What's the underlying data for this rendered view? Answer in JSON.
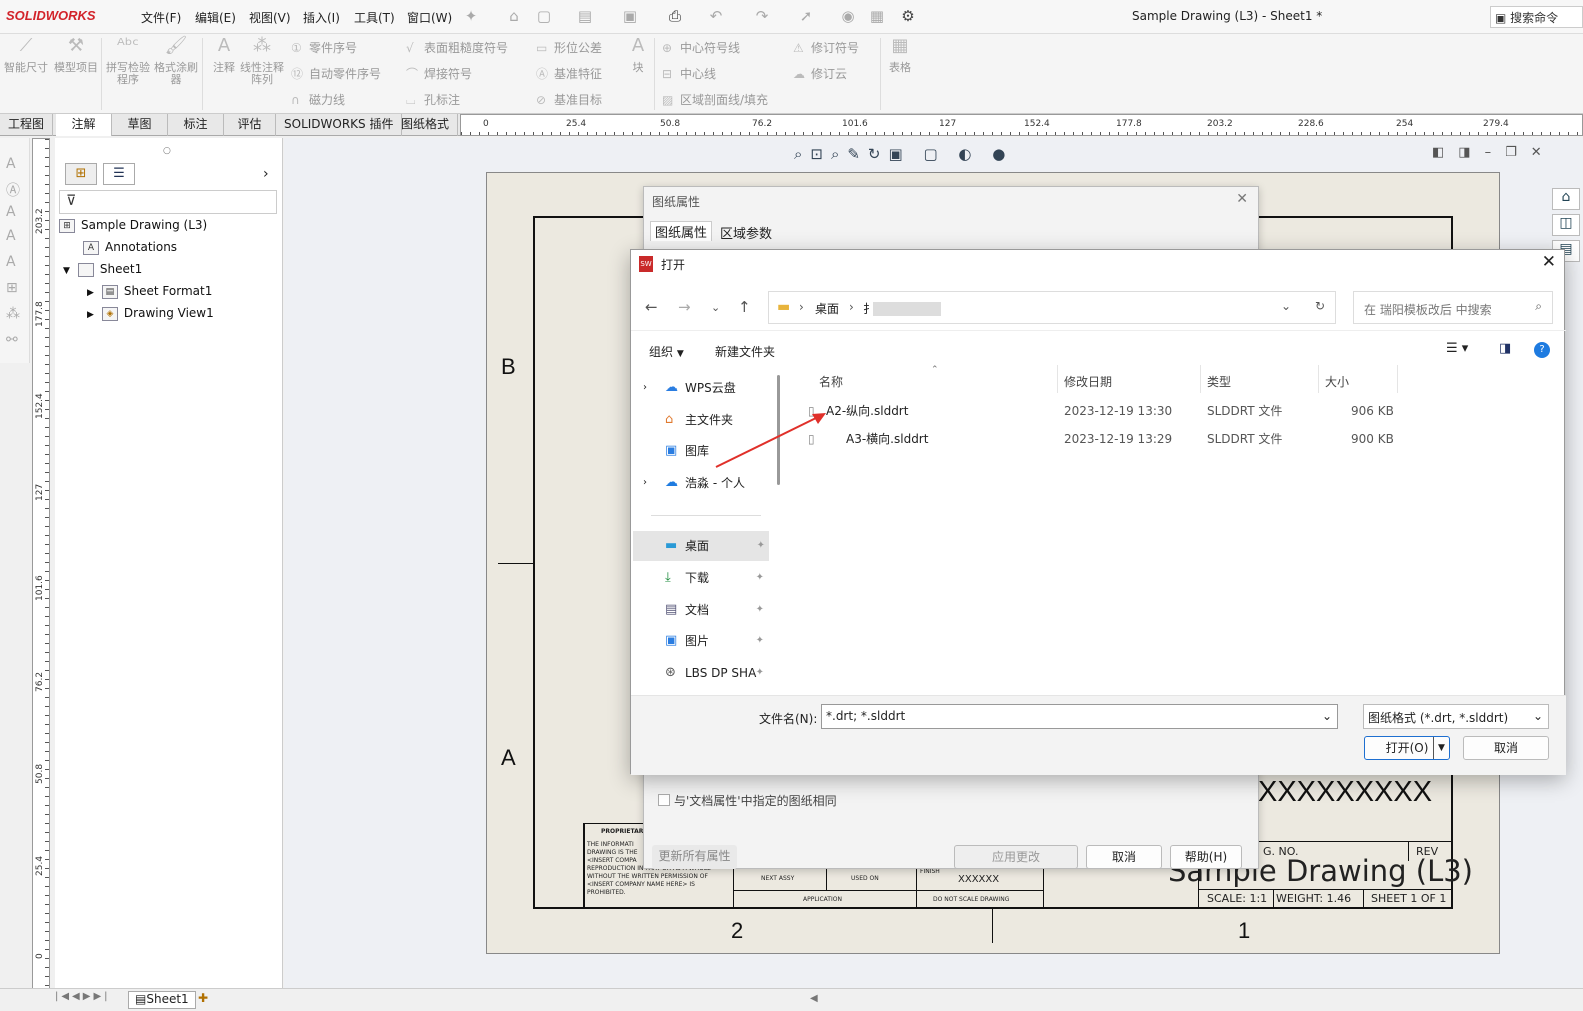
{
  "app": {
    "logo": "SOLIDWORKS",
    "window_title": "Sample Drawing (L3) - Sheet1 *",
    "search_commands": "搜索命令"
  },
  "menu": [
    "文件(F)",
    "编辑(E)",
    "视图(V)",
    "插入(I)",
    "工具(T)",
    "窗口(W)"
  ],
  "ribbon": {
    "big": [
      "智能尺寸",
      "模型项目",
      "拼写检验程序",
      "格式涂刷器",
      "注释",
      "线性注释阵列",
      "块",
      "表格"
    ],
    "col1": [
      "零件序号",
      "自动零件序号",
      "磁力线"
    ],
    "col2": [
      "表面粗糙度符号",
      "焊接符号",
      "孔标注"
    ],
    "col3": [
      "形位公差",
      "基准特征",
      "基准目标"
    ],
    "col4": [
      "中心符号线",
      "中心线",
      "区域剖面线/填充"
    ],
    "col5": [
      "修订符号",
      "修订云"
    ]
  },
  "tabs": [
    "工程图",
    "注解",
    "草图",
    "标注",
    "评估",
    "SOLIDWORKS 插件",
    "图纸格式"
  ],
  "ruler_h": [
    "0",
    "25.4",
    "50.8",
    "76.2",
    "101.6",
    "127",
    "152.4",
    "177.8",
    "203.2",
    "228.6",
    "254",
    "279.4"
  ],
  "ruler_v": [
    "203.2",
    "177.8",
    "152.4",
    "127",
    "101.6",
    "76.2",
    "50.8",
    "25.4",
    "0"
  ],
  "tree": {
    "root": "Sample Drawing (L3)",
    "annotations": "Annotations",
    "sheet": "Sheet1",
    "sheet_format": "Sheet Format1",
    "drawing_view": "Drawing View1"
  },
  "sheet": {
    "zone_b": "B",
    "zone_a": "A",
    "zone_2": "2",
    "zone_1": "1",
    "proprietary": "PROPRIETAR",
    "prop_text": "THE INFORMATI\nDRAWING IS THE\n<INSERT COMPA\nREPRODUCTION IN PART OR AS A WHOLE\nWITHOUT THE WRITTEN PERMISSION OF\n<INSERT COMPANY NAME HERE> IS\nPROHIBITED.",
    "next_assy": "NEXT ASSY",
    "used_on": "USED ON",
    "application": "APPLICATION",
    "finish": "FINISH",
    "xxxxxx": "XXXXXX",
    "no_scale": "DO NOT SCALE DRAWING",
    "big_x": "XXXXXXXXX",
    "dwg_no": "G. NO.",
    "rev": "REV",
    "drawing_name": "Sample Drawing (L3)",
    "scale": "SCALE: 1:1",
    "weight": "WEIGHT: 1.46",
    "sheet_of": "SHEET 1 OF 1"
  },
  "sheet_props": {
    "title": "图纸属性",
    "tab1": "图纸属性",
    "tab2": "区域参数",
    "same_as_doc": "与'文档属性'中指定的图纸相同",
    "update_all": "更新所有属性",
    "apply": "应用更改",
    "cancel": "取消",
    "help": "帮助(H)"
  },
  "open_dialog": {
    "title": "打开",
    "path_desktop": "桌面",
    "path_next": "扌",
    "search_placeholder": "在 瑞阳模板改后 中搜索",
    "organize": "组织",
    "new_folder": "新建文件夹",
    "nav": {
      "wps": "WPS云盘",
      "home": "主文件夹",
      "gallery": "图库",
      "cloud": "浩淼 - 个人",
      "desktop": "桌面",
      "downloads": "下载",
      "documents": "文档",
      "pictures": "图片",
      "lbs": "LBS DP SHA"
    },
    "columns": [
      "名称",
      "修改日期",
      "类型",
      "大小"
    ],
    "files": [
      {
        "name": "A2-纵向.slddrt",
        "date": "2023-12-19 13:30",
        "type": "SLDDRT 文件",
        "size": "906 KB"
      },
      {
        "name": "A3-横向.slddrt",
        "date": "2023-12-19 13:29",
        "type": "SLDDRT 文件",
        "size": "900 KB"
      }
    ],
    "filename_label": "文件名(N):",
    "filename_value": "*.drt; *.slddrt",
    "filter": "图纸格式 (*.drt, *.slddrt)",
    "open": "打开(O)",
    "cancel": "取消"
  },
  "status": {
    "sheet_tab": "Sheet1"
  },
  "colors": {
    "accent_red": "#d2232a",
    "selection": "#cde1f7",
    "sheet_bg": "#ece9e0"
  }
}
